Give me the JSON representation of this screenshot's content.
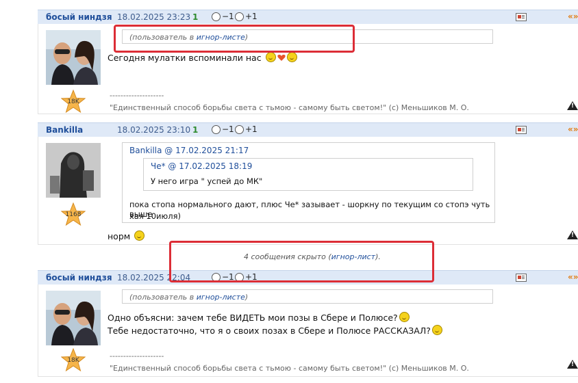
{
  "posts": [
    {
      "author": "босый ниндзя",
      "date": "18.02.2025 23:23",
      "rating": "1",
      "vote_minus": "−1",
      "vote_plus": "+1",
      "quote_link": "«»",
      "ignore_prefix": "(пользователь в ",
      "ignore_link": "игнор-листе",
      "ignore_suffix": ")",
      "text": "Сегодня мулатки вспоминали нас",
      "star_label": "18K",
      "sig_sep": "--------------------",
      "signature": "\"Единственный способ борьбы света с тьмою - самому быть светом!\" (с) Меньшиков М. О."
    },
    {
      "author": "Bankilla",
      "date": "18.02.2025 23:10",
      "rating": "1",
      "vote_minus": "−1",
      "vote_plus": "+1",
      "quote_link": "«»",
      "outer_quote_author": "Bankilla @ 17.02.2025 21:17",
      "inner_quote_author": "Че* @ 17.02.2025 18:19",
      "inner_quote_text": "У него игра \" успей до МК\"",
      "outer_quote_text_line1": "пока стопа нормального дают, плюс Че* зазывает - шоркну по текущим со стопэ чуть выше",
      "outer_quote_text_line2": "хая 10июля)",
      "text": "норм",
      "star_label": "1168"
    },
    {
      "author": "босый ниндзя",
      "date": "18.02.2025 22:04",
      "vote_minus": "−1",
      "vote_plus": "+1",
      "quote_link": "«»",
      "ignore_prefix": "(пользователь в ",
      "ignore_link": "игнор-листе",
      "ignore_suffix": ")",
      "text_line1": "Одно объясни: зачем тебе ВИДЕТЬ мои позы в Сбере и Полюсе?",
      "text_line2": "Тебе недостаточно, что я о своих позах в Сбере и Полюсе РАССКАЗАЛ?",
      "star_label": "18K",
      "sig_sep": "--------------------",
      "signature": "\"Единственный способ борьбы света с тьмою - самому быть светом!\" (с) Меньшиков М. О."
    }
  ],
  "hidden_notice": {
    "prefix": "4 сообщения скрыто (",
    "link": "игнор-лист",
    "suffix": ")."
  },
  "colors": {
    "header_bg": "#dfe9f7",
    "author": "#1f4e9a",
    "rating": "#2e8b2e",
    "quote_link": "#e07b10",
    "highlight": "#dc2d36"
  }
}
